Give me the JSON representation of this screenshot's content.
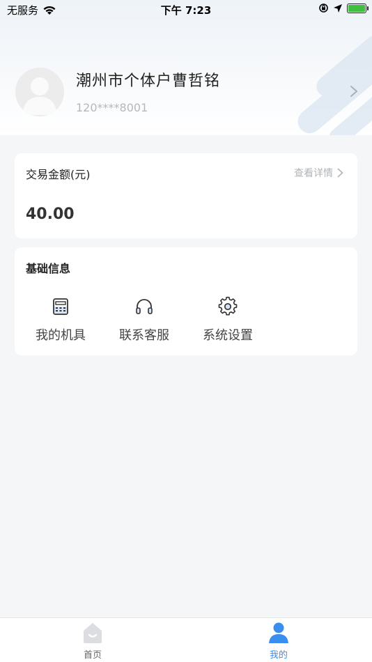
{
  "status_bar": {
    "carrier": "无服务",
    "time": "下午 7:23"
  },
  "profile": {
    "name": "潮州市个体户曹哲铭",
    "phone": "120****8001"
  },
  "transaction_card": {
    "title": "交易金额(元)",
    "detail_link": "查看详情",
    "amount": "40.00"
  },
  "basic_info": {
    "title": "基础信息",
    "items": [
      {
        "label": "我的机具",
        "icon": "calculator-icon"
      },
      {
        "label": "联系客服",
        "icon": "headset-icon"
      },
      {
        "label": "系统设置",
        "icon": "gear-icon"
      }
    ]
  },
  "tabbar": {
    "tabs": [
      {
        "label": "首页",
        "icon": "home-icon",
        "active": false
      },
      {
        "label": "我的",
        "icon": "user-icon",
        "active": true
      }
    ],
    "active_color": "#3a8ef0",
    "inactive_color": "#666666"
  }
}
